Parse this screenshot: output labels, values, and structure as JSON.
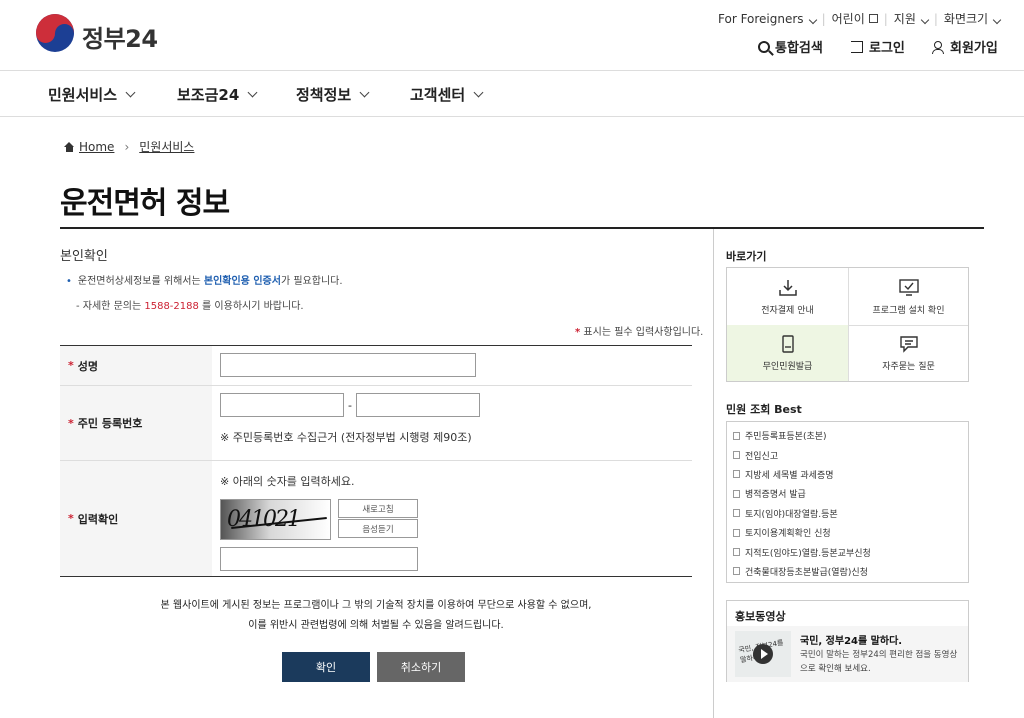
{
  "header": {
    "logo_text": "정부24",
    "util": {
      "foreigners": "For Foreigners",
      "kids": "어린이",
      "support": "지원",
      "screen_size": "화면크기"
    },
    "actions": {
      "search": "통합검색",
      "login": "로그인",
      "signup": "회원가입"
    }
  },
  "gnb": [
    "민원서비스",
    "보조금24",
    "정책정보",
    "고객센터"
  ],
  "breadcrumb": {
    "home": "Home",
    "current": "민원서비스"
  },
  "page_title": "운전면허 정보",
  "section_title": "본인확인",
  "notes": {
    "line1_pre": "운전면허상세정보를 위해서는 ",
    "line1_em": "본인확인용 인증서",
    "line1_post": "가 필요합니다.",
    "line2_pre": "- 자세한 문의는 ",
    "line2_phone": "1588-2188",
    "line2_post": " 를 이용하시기 바랍니다.",
    "required_star": "*",
    "required": " 표시는 필수 입력사항입니다."
  },
  "form": {
    "name_label": "성명",
    "rrn_label": "주민 등록번호",
    "rrn_dash": "-",
    "rrn_hint": "※ 주민등록번호 수집근거 (전자정부법 시행령 제90조)",
    "captcha_label": "입력확인",
    "captcha_hint": "※ 아래의 숫자를 입력하세요.",
    "captcha_value": "041021",
    "refresh": "새로고침",
    "audio": "음성듣기"
  },
  "disclaimer": {
    "line1": "본 웹사이트에 게시된 정보는 프로그램이나 그 밖의 기술적 장치를 이용하여 무단으로 사용할 수 없으며,",
    "line2": "이를 위반시 관련법령에 의해 처벌될 수 있음을 알려드립니다."
  },
  "buttons": {
    "confirm": "확인",
    "cancel": "취소하기"
  },
  "sidebar": {
    "shortcuts_title": "바로가기",
    "shortcuts": [
      {
        "label": "전자결제 안내",
        "icon": "download-icon",
        "highlight": false
      },
      {
        "label": "프로그램 설치 확인",
        "icon": "monitor-check-icon",
        "highlight": false
      },
      {
        "label": "무인민원발급",
        "icon": "kiosk-icon",
        "highlight": true
      },
      {
        "label": "자주묻는 질문",
        "icon": "chat-icon",
        "highlight": false
      }
    ],
    "best_title": "민원 조회 Best",
    "best": [
      "주민등록표등본(초본)",
      "전입신고",
      "지방세 세목별 과세증명",
      "병적증명서 발급",
      "토지(임야)대장열람.등본",
      "토지이용계획확인 신청",
      "지적도(임야도)열람.등본교부신청",
      "건축물대장등초본발급(열람)신청"
    ],
    "promo_title": "홍보동영상",
    "promo_thumb_text": "국민, 정부24를 말하다",
    "promo_heading": "국민, 정부24를 말하다.",
    "promo_desc": "국민이 말하는 정부24의 편리한 점을 동영상으로 확인해 보세요."
  },
  "colors": {
    "accent_navy": "#1b3a5c",
    "required_red": "#cc2233",
    "link_blue": "#1f5fb0",
    "highlight_green": "#eef6e3"
  }
}
